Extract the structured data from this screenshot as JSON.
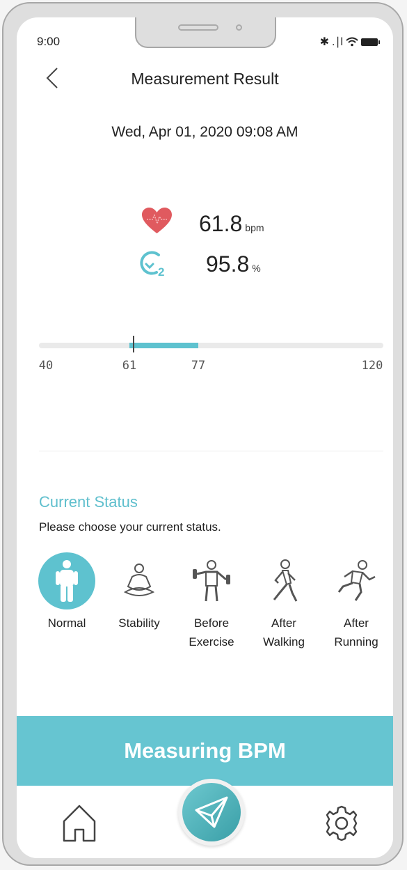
{
  "status_bar": {
    "time": "9:00",
    "bluetooth": "✱",
    "signal": ".∣l"
  },
  "header": {
    "title": "Measurement Result",
    "back_icon": "chevron-left-icon"
  },
  "measurement": {
    "datetime": "Wed, Apr 01, 2020 09:08 AM",
    "heart_rate": {
      "value": "61.8",
      "unit": "bpm",
      "icon": "heart-icon"
    },
    "spo2": {
      "value": "95.8",
      "unit": "%",
      "icon": "o2-icon"
    }
  },
  "range_bar": {
    "min": 40,
    "max": 120,
    "normal_low": 61,
    "normal_high": 77,
    "marker": 61.8,
    "labels": {
      "min": "40",
      "low": "61",
      "high": "77",
      "max": "120"
    },
    "accent": "#5ec2cf"
  },
  "current_status": {
    "title": "Current Status",
    "subtitle": "Please choose your current status.",
    "selected": "Normal",
    "options": [
      {
        "label": "Normal",
        "icon": "person-standing-icon"
      },
      {
        "label": "Stability",
        "icon": "meditation-icon"
      },
      {
        "label": "Before\nExercise",
        "icon": "dumbbell-person-icon"
      },
      {
        "label": "After\nWalking",
        "icon": "walking-person-icon"
      },
      {
        "label": "After\nRunning",
        "icon": "running-person-icon"
      }
    ]
  },
  "cta": {
    "label": "Measuring BPM"
  },
  "bottom_nav": {
    "home_icon": "home-icon",
    "send_icon": "send-icon",
    "settings_icon": "gear-icon"
  },
  "colors": {
    "accent": "#5ec2cf",
    "heart": "#e05a5f"
  }
}
